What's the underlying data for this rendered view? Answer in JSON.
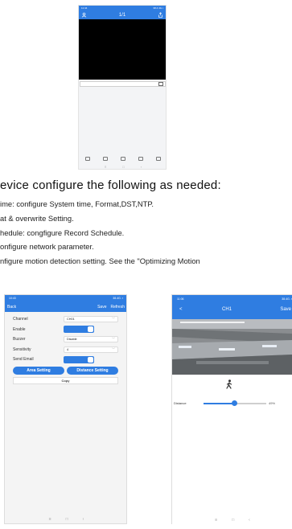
{
  "phone_top": {
    "status_time": "11:44",
    "status_right": "38.4 4G ▪",
    "page_indicator": "1/1",
    "nav": [
      "≡",
      "□",
      "‹"
    ]
  },
  "heading": "evice configure the following as needed:",
  "lines": [
    "ime: configure System time, Format,DST,NTP.",
    "at & overwrite Setting.",
    "hedule: congfigure Record Schedule.",
    "onfigure network parameter.",
    "nfigure motion detection setting. See the \"Optimizing Motion"
  ],
  "phone_motion": {
    "status_time": "10:43",
    "status_right": "38.4G. ▪",
    "back": "Back",
    "save": "Save",
    "refresh": "Refresh",
    "rows": {
      "channel_label": "Channel",
      "channel_value": "CH01",
      "enable_label": "Enable",
      "enable_on": true,
      "buzzer_label": "Buzzer",
      "buzzer_value": "Disable",
      "sensitivity_label": "Sensitivity",
      "sensitivity_value": "4",
      "send_email_label": "Send Email",
      "send_email_on": true
    },
    "area_setting": "Area Setting",
    "distance_setting": "Distance Setting",
    "copy": "Copy",
    "nav": [
      "≡",
      "□",
      "‹"
    ]
  },
  "phone_distance": {
    "status_time": "11:06",
    "status_right": "38.4G. ▪",
    "back": "<",
    "title": "CH1",
    "save": "Save",
    "distance_label": "Distance",
    "distance_value": 49,
    "distance_text": "49%",
    "nav": [
      "≡",
      "□",
      "‹"
    ]
  },
  "colors": {
    "accent": "#2f7de1"
  }
}
